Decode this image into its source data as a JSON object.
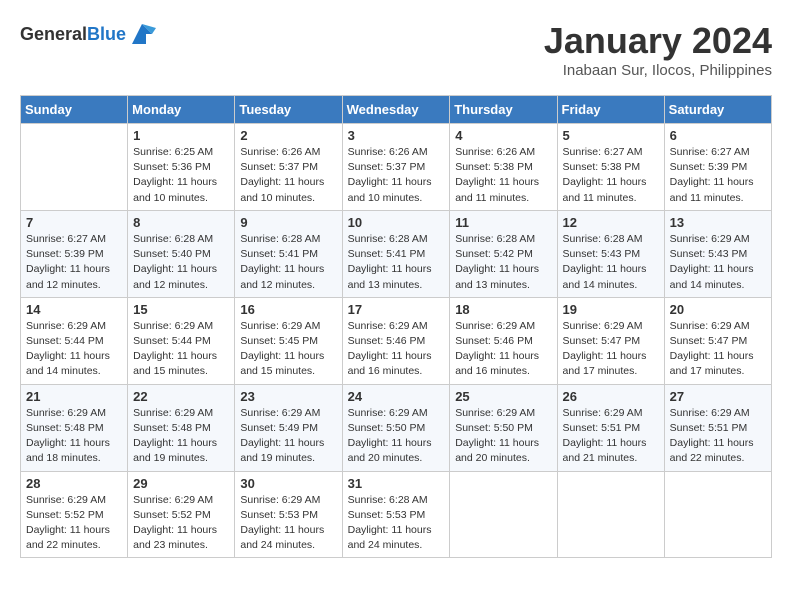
{
  "header": {
    "logo_general": "General",
    "logo_blue": "Blue",
    "title": "January 2024",
    "subtitle": "Inabaan Sur, Ilocos, Philippines"
  },
  "days_of_week": [
    "Sunday",
    "Monday",
    "Tuesday",
    "Wednesday",
    "Thursday",
    "Friday",
    "Saturday"
  ],
  "weeks": [
    [
      {
        "day": "",
        "sunrise": "",
        "sunset": "",
        "daylight": ""
      },
      {
        "day": "1",
        "sunrise": "Sunrise: 6:25 AM",
        "sunset": "Sunset: 5:36 PM",
        "daylight": "Daylight: 11 hours and 10 minutes."
      },
      {
        "day": "2",
        "sunrise": "Sunrise: 6:26 AM",
        "sunset": "Sunset: 5:37 PM",
        "daylight": "Daylight: 11 hours and 10 minutes."
      },
      {
        "day": "3",
        "sunrise": "Sunrise: 6:26 AM",
        "sunset": "Sunset: 5:37 PM",
        "daylight": "Daylight: 11 hours and 10 minutes."
      },
      {
        "day": "4",
        "sunrise": "Sunrise: 6:26 AM",
        "sunset": "Sunset: 5:38 PM",
        "daylight": "Daylight: 11 hours and 11 minutes."
      },
      {
        "day": "5",
        "sunrise": "Sunrise: 6:27 AM",
        "sunset": "Sunset: 5:38 PM",
        "daylight": "Daylight: 11 hours and 11 minutes."
      },
      {
        "day": "6",
        "sunrise": "Sunrise: 6:27 AM",
        "sunset": "Sunset: 5:39 PM",
        "daylight": "Daylight: 11 hours and 11 minutes."
      }
    ],
    [
      {
        "day": "7",
        "sunrise": "Sunrise: 6:27 AM",
        "sunset": "Sunset: 5:39 PM",
        "daylight": "Daylight: 11 hours and 12 minutes."
      },
      {
        "day": "8",
        "sunrise": "Sunrise: 6:28 AM",
        "sunset": "Sunset: 5:40 PM",
        "daylight": "Daylight: 11 hours and 12 minutes."
      },
      {
        "day": "9",
        "sunrise": "Sunrise: 6:28 AM",
        "sunset": "Sunset: 5:41 PM",
        "daylight": "Daylight: 11 hours and 12 minutes."
      },
      {
        "day": "10",
        "sunrise": "Sunrise: 6:28 AM",
        "sunset": "Sunset: 5:41 PM",
        "daylight": "Daylight: 11 hours and 13 minutes."
      },
      {
        "day": "11",
        "sunrise": "Sunrise: 6:28 AM",
        "sunset": "Sunset: 5:42 PM",
        "daylight": "Daylight: 11 hours and 13 minutes."
      },
      {
        "day": "12",
        "sunrise": "Sunrise: 6:28 AM",
        "sunset": "Sunset: 5:43 PM",
        "daylight": "Daylight: 11 hours and 14 minutes."
      },
      {
        "day": "13",
        "sunrise": "Sunrise: 6:29 AM",
        "sunset": "Sunset: 5:43 PM",
        "daylight": "Daylight: 11 hours and 14 minutes."
      }
    ],
    [
      {
        "day": "14",
        "sunrise": "Sunrise: 6:29 AM",
        "sunset": "Sunset: 5:44 PM",
        "daylight": "Daylight: 11 hours and 14 minutes."
      },
      {
        "day": "15",
        "sunrise": "Sunrise: 6:29 AM",
        "sunset": "Sunset: 5:44 PM",
        "daylight": "Daylight: 11 hours and 15 minutes."
      },
      {
        "day": "16",
        "sunrise": "Sunrise: 6:29 AM",
        "sunset": "Sunset: 5:45 PM",
        "daylight": "Daylight: 11 hours and 15 minutes."
      },
      {
        "day": "17",
        "sunrise": "Sunrise: 6:29 AM",
        "sunset": "Sunset: 5:46 PM",
        "daylight": "Daylight: 11 hours and 16 minutes."
      },
      {
        "day": "18",
        "sunrise": "Sunrise: 6:29 AM",
        "sunset": "Sunset: 5:46 PM",
        "daylight": "Daylight: 11 hours and 16 minutes."
      },
      {
        "day": "19",
        "sunrise": "Sunrise: 6:29 AM",
        "sunset": "Sunset: 5:47 PM",
        "daylight": "Daylight: 11 hours and 17 minutes."
      },
      {
        "day": "20",
        "sunrise": "Sunrise: 6:29 AM",
        "sunset": "Sunset: 5:47 PM",
        "daylight": "Daylight: 11 hours and 17 minutes."
      }
    ],
    [
      {
        "day": "21",
        "sunrise": "Sunrise: 6:29 AM",
        "sunset": "Sunset: 5:48 PM",
        "daylight": "Daylight: 11 hours and 18 minutes."
      },
      {
        "day": "22",
        "sunrise": "Sunrise: 6:29 AM",
        "sunset": "Sunset: 5:48 PM",
        "daylight": "Daylight: 11 hours and 19 minutes."
      },
      {
        "day": "23",
        "sunrise": "Sunrise: 6:29 AM",
        "sunset": "Sunset: 5:49 PM",
        "daylight": "Daylight: 11 hours and 19 minutes."
      },
      {
        "day": "24",
        "sunrise": "Sunrise: 6:29 AM",
        "sunset": "Sunset: 5:50 PM",
        "daylight": "Daylight: 11 hours and 20 minutes."
      },
      {
        "day": "25",
        "sunrise": "Sunrise: 6:29 AM",
        "sunset": "Sunset: 5:50 PM",
        "daylight": "Daylight: 11 hours and 20 minutes."
      },
      {
        "day": "26",
        "sunrise": "Sunrise: 6:29 AM",
        "sunset": "Sunset: 5:51 PM",
        "daylight": "Daylight: 11 hours and 21 minutes."
      },
      {
        "day": "27",
        "sunrise": "Sunrise: 6:29 AM",
        "sunset": "Sunset: 5:51 PM",
        "daylight": "Daylight: 11 hours and 22 minutes."
      }
    ],
    [
      {
        "day": "28",
        "sunrise": "Sunrise: 6:29 AM",
        "sunset": "Sunset: 5:52 PM",
        "daylight": "Daylight: 11 hours and 22 minutes."
      },
      {
        "day": "29",
        "sunrise": "Sunrise: 6:29 AM",
        "sunset": "Sunset: 5:52 PM",
        "daylight": "Daylight: 11 hours and 23 minutes."
      },
      {
        "day": "30",
        "sunrise": "Sunrise: 6:29 AM",
        "sunset": "Sunset: 5:53 PM",
        "daylight": "Daylight: 11 hours and 24 minutes."
      },
      {
        "day": "31",
        "sunrise": "Sunrise: 6:28 AM",
        "sunset": "Sunset: 5:53 PM",
        "daylight": "Daylight: 11 hours and 24 minutes."
      },
      {
        "day": "",
        "sunrise": "",
        "sunset": "",
        "daylight": ""
      },
      {
        "day": "",
        "sunrise": "",
        "sunset": "",
        "daylight": ""
      },
      {
        "day": "",
        "sunrise": "",
        "sunset": "",
        "daylight": ""
      }
    ]
  ]
}
